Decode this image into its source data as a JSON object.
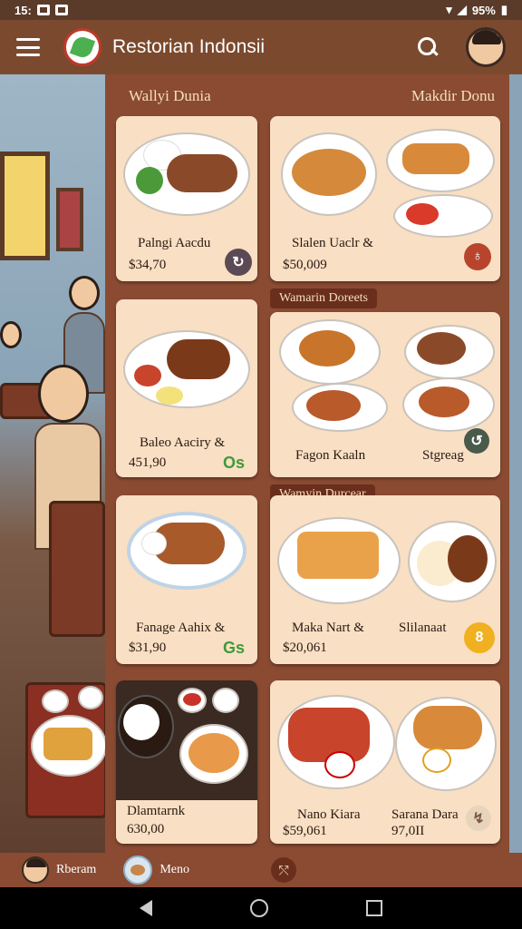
{
  "status": {
    "time": "15:",
    "battery": "95%"
  },
  "app": {
    "title": "Restorian Indonsii"
  },
  "sections": {
    "left_header": "Wallyi Dunia",
    "right_header": "Makdir Donu",
    "ribbon_1": "Wamarin Doreets",
    "ribbon_2": "Wamyin Durcear"
  },
  "cards": [
    {
      "name": "Palngi Aacdu",
      "price": "$34,70",
      "badge": "↻"
    },
    {
      "name": "Slalen Uaclr &",
      "price": "$50,009",
      "badge": "♁"
    },
    {
      "name": "Baleo Aaciry &",
      "price": "451,90",
      "tag": "Os"
    },
    {
      "name": "Fagon Kaaln",
      "name2": "Stgreag",
      "badge": "↺"
    },
    {
      "name": "Fanage Aahix &",
      "price": "$31,90",
      "tag": "Gs"
    },
    {
      "name": "Maka Nart &",
      "price": "$20,061",
      "name2": "Slilanaat",
      "badge": "8"
    },
    {
      "name": "Dlamtarnk",
      "price": "630,00"
    },
    {
      "name": "Nano Kiara",
      "price": "$59,061",
      "name2": "Sarana Dara",
      "price2": "97,0II",
      "badge": "↯"
    }
  ],
  "bottom_nav": {
    "item1": "Rberam",
    "item2": "Meno",
    "action": "⤲"
  }
}
